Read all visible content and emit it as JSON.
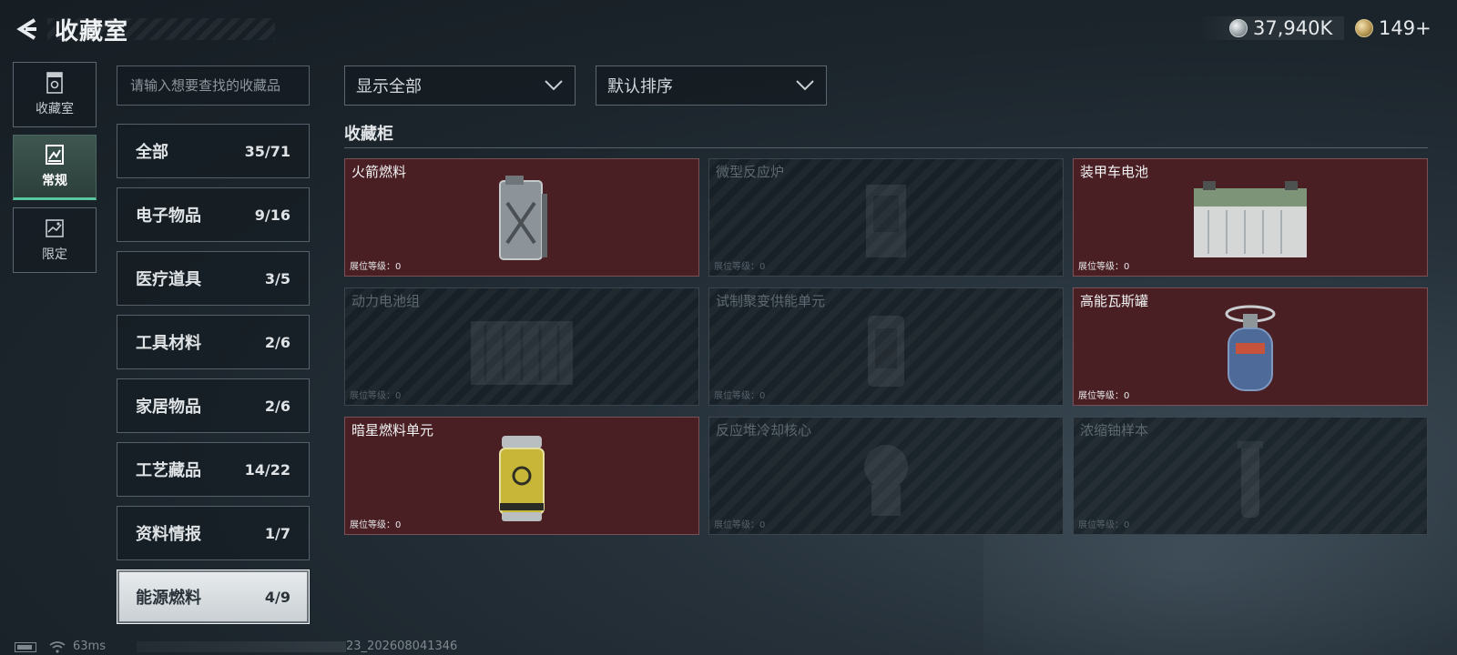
{
  "header": {
    "title": "收藏室",
    "currency_silver": "37,940K",
    "currency_gold": "149+"
  },
  "side_nav": [
    {
      "label": "收藏室",
      "icon": "collection-room-icon",
      "active": false
    },
    {
      "label": "常规",
      "icon": "regular-icon",
      "active": true
    },
    {
      "label": "限定",
      "icon": "limited-icon",
      "active": false
    }
  ],
  "search": {
    "placeholder": "请输入想要查找的收藏品"
  },
  "categories": [
    {
      "name": "全部",
      "count": "35/71"
    },
    {
      "name": "电子物品",
      "count": "9/16"
    },
    {
      "name": "医疗道具",
      "count": "3/5"
    },
    {
      "name": "工具材料",
      "count": "2/6"
    },
    {
      "name": "家居物品",
      "count": "2/6"
    },
    {
      "name": "工艺藏品",
      "count": "14/22"
    },
    {
      "name": "资料情报",
      "count": "1/7"
    },
    {
      "name": "能源燃料",
      "count": "4/9"
    }
  ],
  "active_category": 7,
  "filters": {
    "display": "显示全部",
    "sort": "默认排序"
  },
  "section": {
    "title": "收藏柜"
  },
  "items": [
    {
      "name": "火箭燃料",
      "level": "展位等级：0",
      "owned": true,
      "icon": "fuel-canister-icon"
    },
    {
      "name": "微型反应炉",
      "level": "展位等级：0",
      "owned": false,
      "icon": "micro-reactor-icon"
    },
    {
      "name": "装甲车电池",
      "level": "展位等级：0",
      "owned": true,
      "icon": "vehicle-battery-icon"
    },
    {
      "name": "动力电池组",
      "level": "展位等级：0",
      "owned": false,
      "icon": "battery-pack-icon"
    },
    {
      "name": "试制聚变供能单元",
      "level": "展位等级：0",
      "owned": false,
      "icon": "fusion-unit-icon"
    },
    {
      "name": "高能瓦斯罐",
      "level": "展位等级：0",
      "owned": true,
      "icon": "gas-tank-icon"
    },
    {
      "name": "暗星燃料单元",
      "level": "展位等级：0",
      "owned": true,
      "icon": "fuel-cell-icon"
    },
    {
      "name": "反应堆冷却核心",
      "level": "展位等级：0",
      "owned": false,
      "icon": "reactor-core-icon"
    },
    {
      "name": "浓缩铀样本",
      "level": "展位等级：0",
      "owned": false,
      "icon": "uranium-sample-icon"
    }
  ],
  "footer": {
    "ping": "63ms",
    "build": "23_202608041346"
  },
  "colors": {
    "owned_card": "#4a1f23",
    "active_tab_accent": "#58c7a0"
  }
}
